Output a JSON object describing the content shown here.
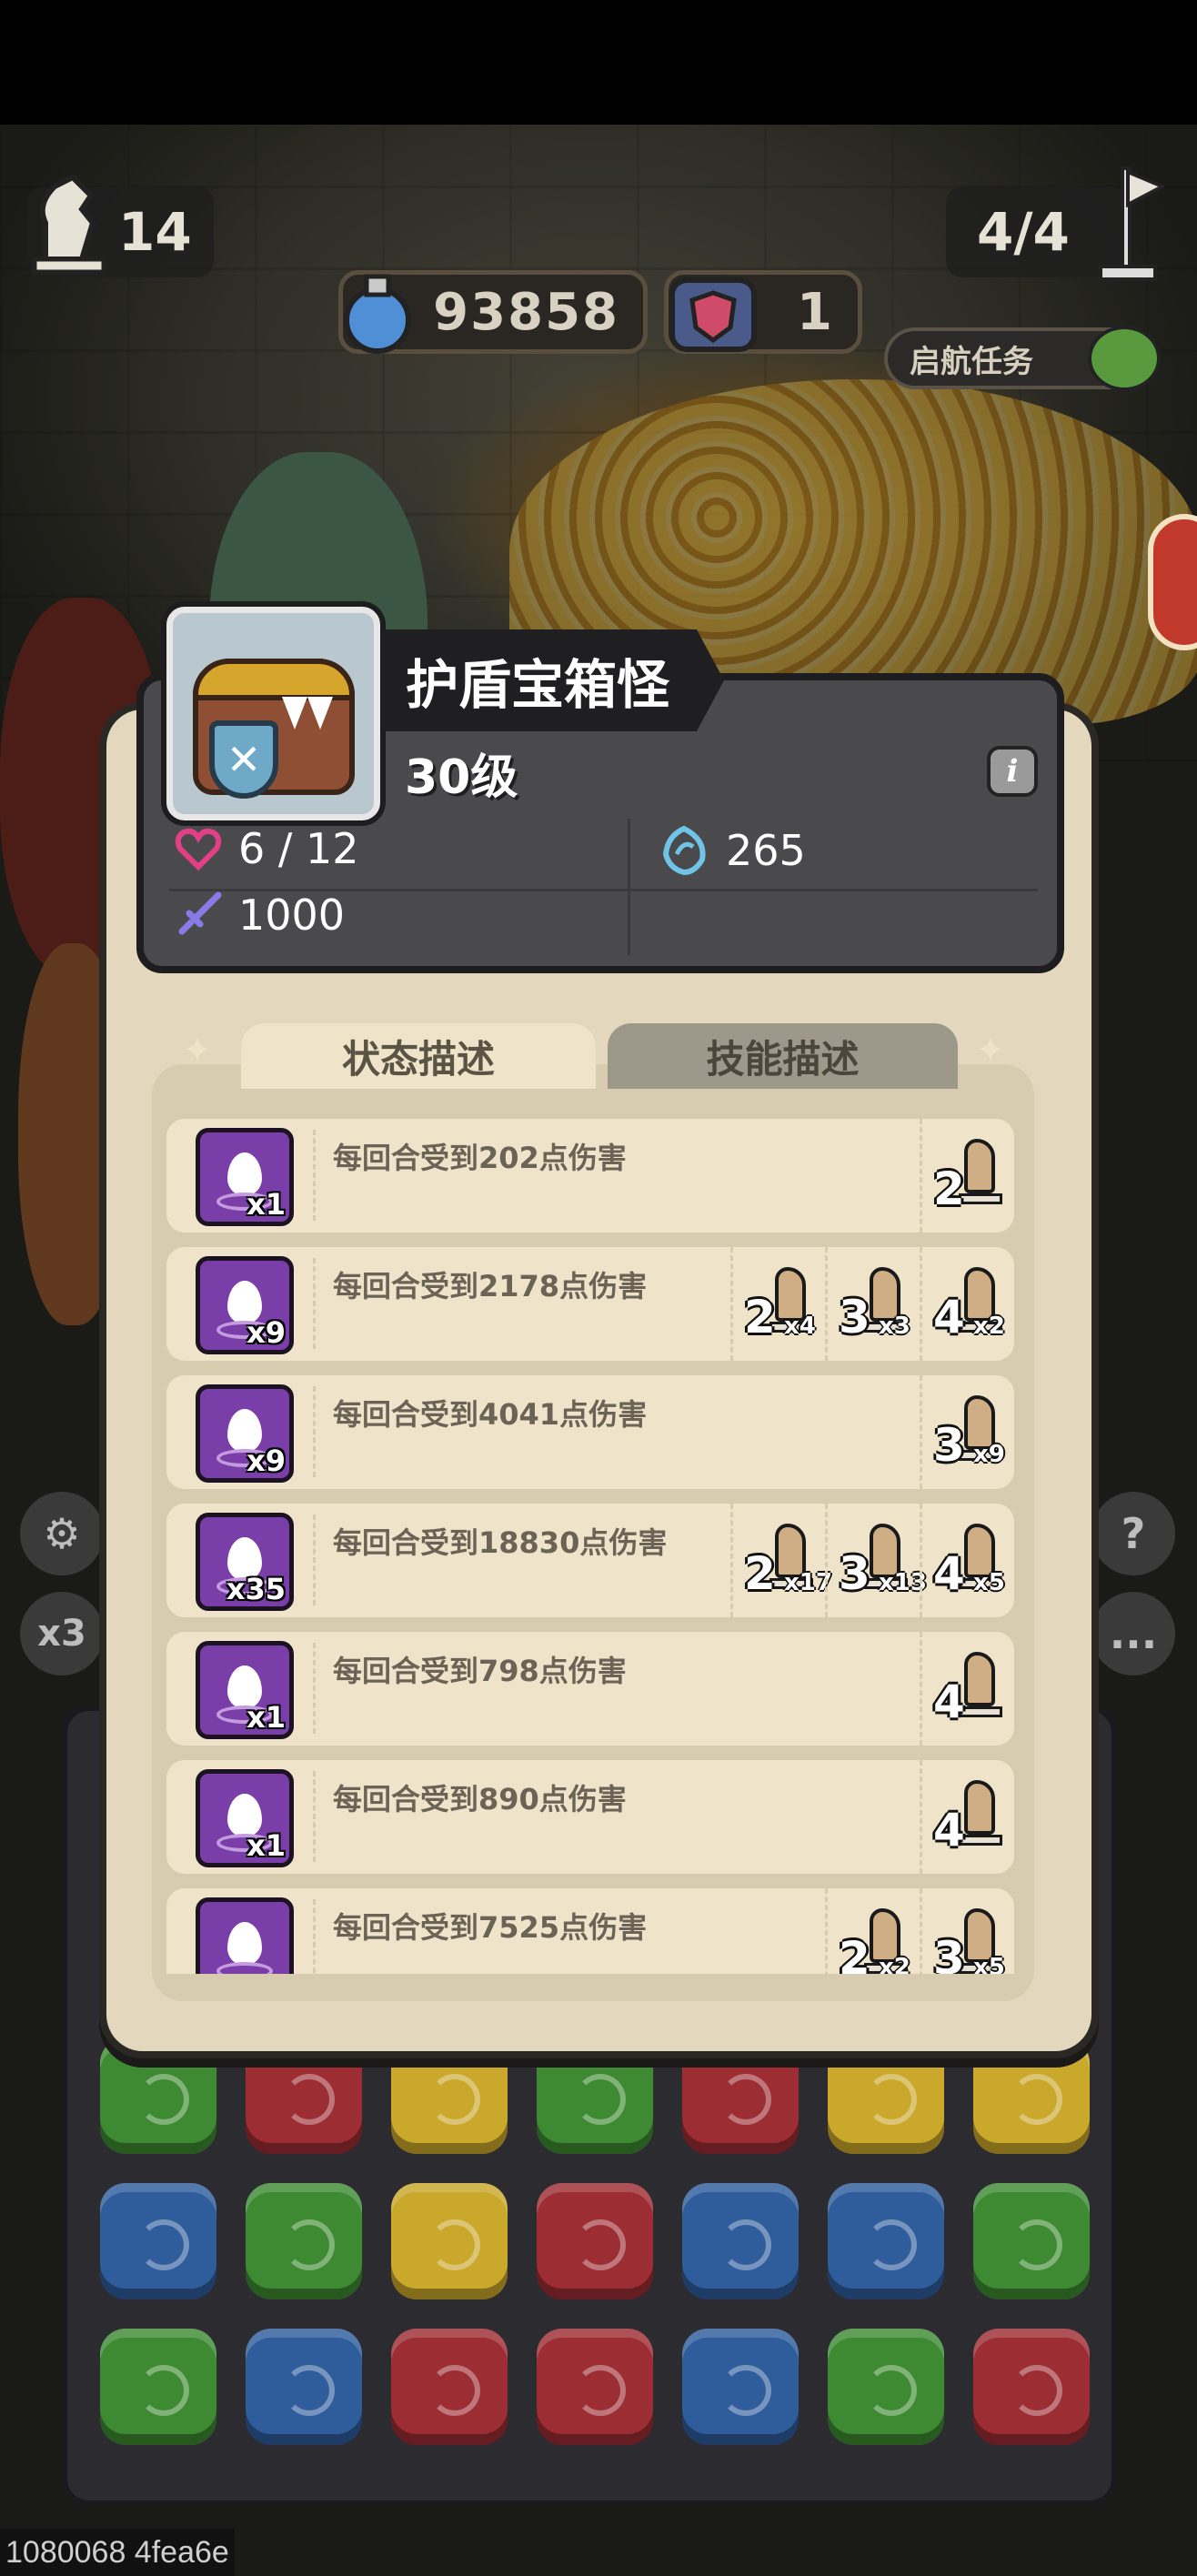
{
  "hud": {
    "turn_count": "14",
    "wave": "4/4",
    "potion_count": "93858",
    "shield_count": "1",
    "quest_label": "启航任务"
  },
  "side": {
    "speed_label": "x3",
    "help_label": "?",
    "more_label": "..."
  },
  "monster": {
    "name": "护盾宝箱怪",
    "level": "30级",
    "info_label": "i",
    "hp": "6 / 12",
    "defense": "265",
    "attack": "1000"
  },
  "tabs": {
    "status": "状态描述",
    "skill": "技能描述"
  },
  "status_rows": [
    {
      "count": "x1",
      "text": "每回合受到202点伤害",
      "badges": [
        {
          "level": "2",
          "mult": ""
        }
      ]
    },
    {
      "count": "x9",
      "text": "每回合受到2178点伤害",
      "badges": [
        {
          "level": "2",
          "mult": "x4"
        },
        {
          "level": "3",
          "mult": "x3"
        },
        {
          "level": "4",
          "mult": "x2"
        }
      ]
    },
    {
      "count": "x9",
      "text": "每回合受到4041点伤害",
      "badges": [
        {
          "level": "3",
          "mult": "x9"
        }
      ]
    },
    {
      "count": "x35",
      "text": "每回合受到18830点伤害",
      "badges": [
        {
          "level": "2",
          "mult": "x17"
        },
        {
          "level": "3",
          "mult": "x13"
        },
        {
          "level": "4",
          "mult": "x5"
        }
      ]
    },
    {
      "count": "x1",
      "text": "每回合受到798点伤害",
      "badges": [
        {
          "level": "4",
          "mult": ""
        }
      ]
    },
    {
      "count": "x1",
      "text": "每回合受到890点伤害",
      "badges": [
        {
          "level": "4",
          "mult": ""
        }
      ]
    },
    {
      "count": "",
      "text": "每回合受到7525点伤害",
      "badges": [
        {
          "level": "2",
          "mult": "x2"
        },
        {
          "level": "3",
          "mult": "x5"
        }
      ]
    }
  ],
  "debug_text": "1080068 4fea6e",
  "colors": {
    "panel": "#e3d7bd",
    "header": "#4a4a4d",
    "row": "#efe4c9",
    "icon": "#7a3ea8"
  }
}
